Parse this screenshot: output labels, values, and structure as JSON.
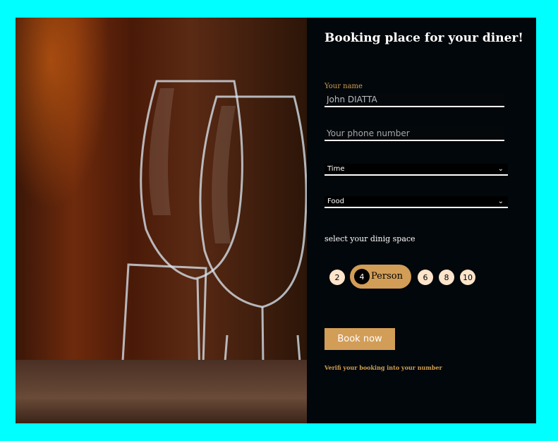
{
  "form": {
    "title": "Booking place for your diner!",
    "name_label": "Your name",
    "name_value": "John DIATTA",
    "phone_placeholder": "Your phone number",
    "time_select": "Time",
    "food_select": "Food",
    "space_label": "select your dinig space",
    "options": [
      "2",
      "4",
      "6",
      "8",
      "10"
    ],
    "selected_suffix": "Person",
    "book_button": "Book now",
    "verify_note": "Verifi your booking into your number"
  },
  "colors": {
    "background": "#00ffff",
    "panel": "#02070b",
    "accent": "#d29d57",
    "bubble": "#fde4cb"
  },
  "icons": {
    "select_arrow": "chevron-down-icon"
  }
}
